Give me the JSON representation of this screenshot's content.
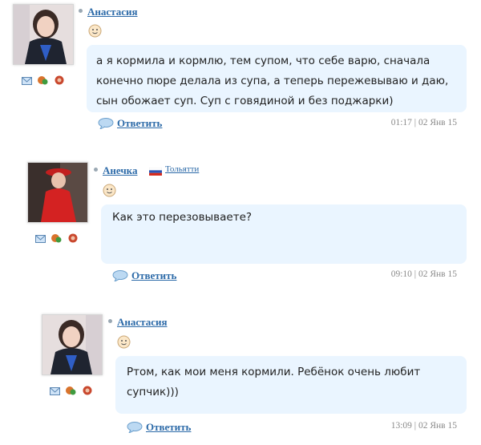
{
  "comments": [
    {
      "author": "Анастасия",
      "text": "а я кормила и кормлю, тем супом, что себе варю, сначала конечно пюре делала из супа, а теперь пережевываю и даю, сын обожает суп. Суп с говядиной и без поджарки)",
      "reply_label": "Ответить",
      "time": "01:17",
      "date": "02 Янв 15"
    },
    {
      "author": "Анечка",
      "city": "Тольятти",
      "text": "Как это перезовываете?",
      "reply_label": "Ответить",
      "time": "09:10",
      "date": "02 Янв 15"
    },
    {
      "author": "Анастасия",
      "text": "Ртом, как мои меня кормили. Ребёнок очень любит супчик)))",
      "reply_label": "Ответить",
      "time": "13:09",
      "date": "02 Янв 15"
    }
  ],
  "meta_separator": "|",
  "icons": [
    "mail-icon",
    "add-friend-icon",
    "gift-icon",
    "smiley-icon",
    "reply-bubble-icon",
    "russia-flag-icon"
  ],
  "colors": {
    "link": "#2c6aa8",
    "bubble": "#eaf5ff",
    "meta": "#8a8a8a"
  }
}
